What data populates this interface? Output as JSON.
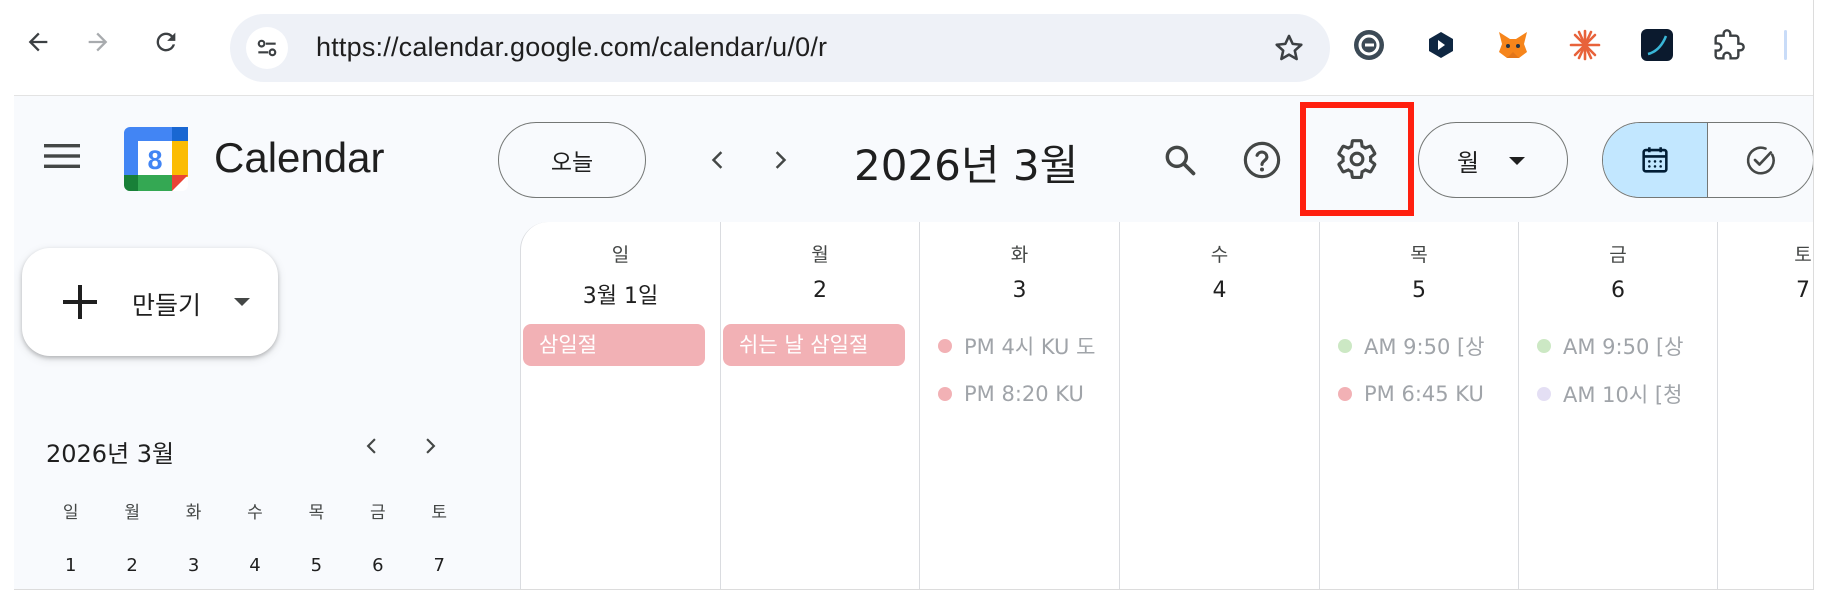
{
  "browser": {
    "url": "https://calendar.google.com/calendar/u/0/r"
  },
  "app": {
    "title": "Calendar",
    "logo_number": "8"
  },
  "header": {
    "today_label": "오늘",
    "month_title": "2026년 3월",
    "view_label": "월"
  },
  "sidebar": {
    "create_label": "만들기",
    "mini_cal": {
      "title": "2026년 3월",
      "weekdays": [
        "일",
        "월",
        "화",
        "수",
        "목",
        "금",
        "토"
      ],
      "week1": [
        "1",
        "2",
        "3",
        "4",
        "5",
        "6",
        "7"
      ]
    }
  },
  "grid": {
    "days": [
      {
        "dow": "일",
        "num": "3월 1일"
      },
      {
        "dow": "월",
        "num": "2"
      },
      {
        "dow": "화",
        "num": "3"
      },
      {
        "dow": "수",
        "num": "4"
      },
      {
        "dow": "목",
        "num": "5"
      },
      {
        "dow": "금",
        "num": "6"
      },
      {
        "dow": "토",
        "num": "7"
      }
    ],
    "allday": [
      "삼일절",
      "쉬는 날 삼일절"
    ],
    "events": {
      "tue_1": "PM 4시 KU 도",
      "tue_2": "PM 8:20 KU",
      "thu_1": "AM 9:50 [상",
      "thu_2": "PM 6:45 KU",
      "fri_1": "AM 9:50 [상",
      "fri_2": "AM 10시 [청"
    }
  },
  "colors": {
    "accent_highlight": "#ff1f0f",
    "holiday_chip": "#f2b1b5",
    "dot_pink": "#f2b1b5",
    "dot_green": "#cce8c4",
    "dot_lavender": "#e4dff4",
    "active_toggle": "#c2e7ff"
  }
}
